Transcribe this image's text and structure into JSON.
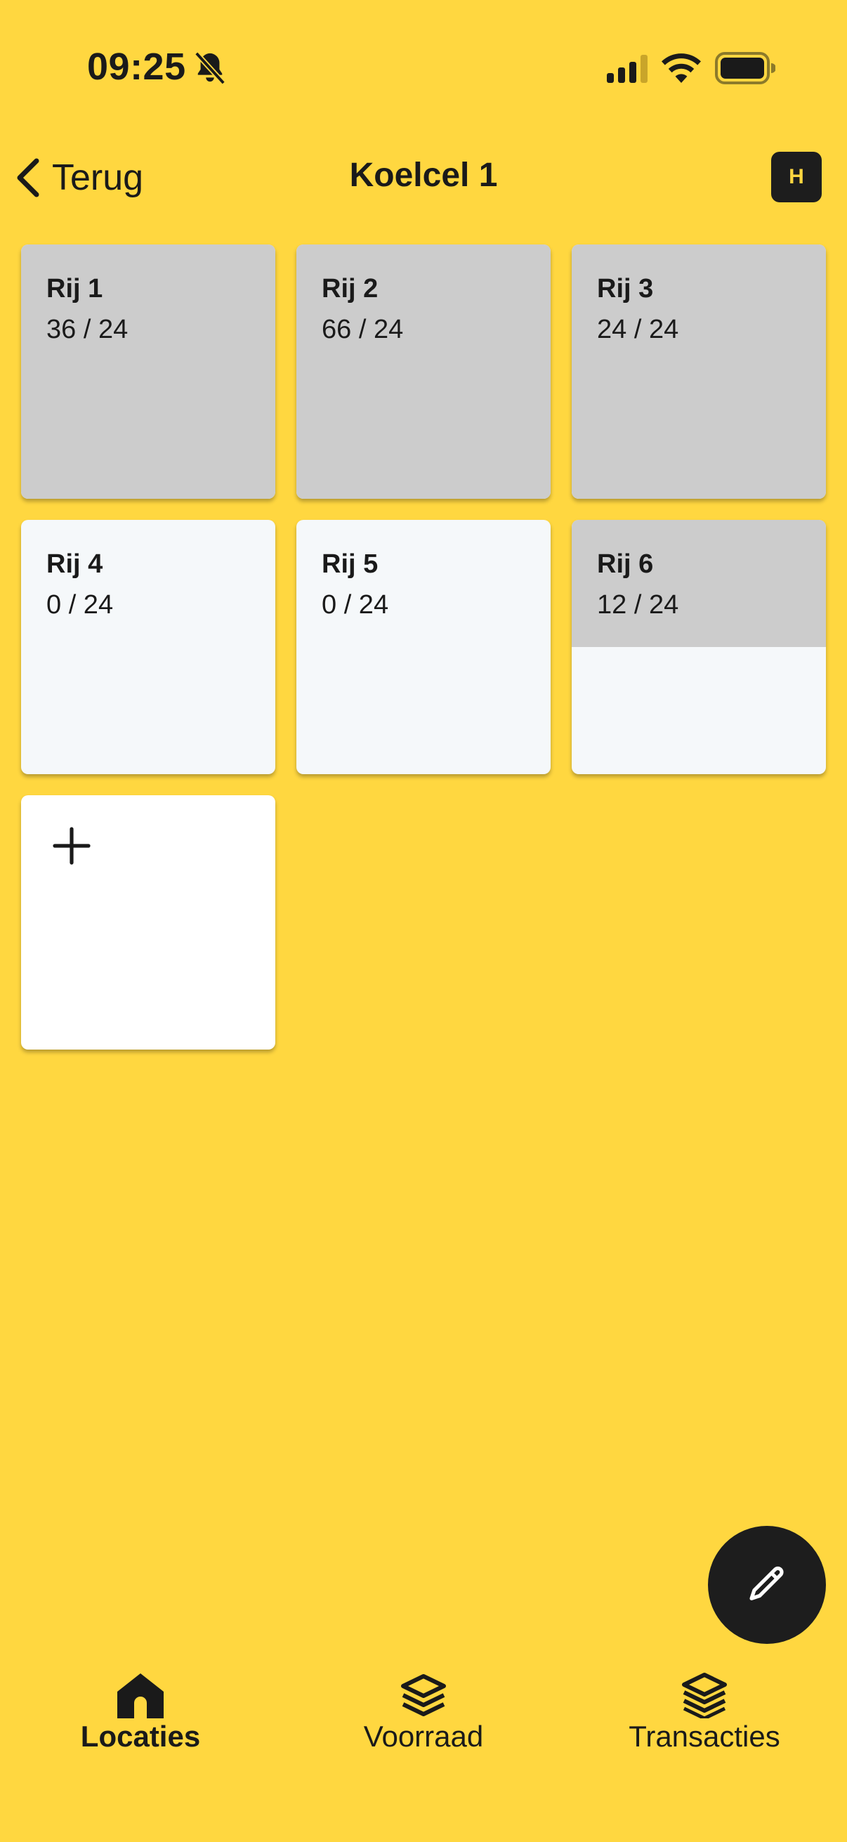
{
  "status_bar": {
    "time": "09:25"
  },
  "header": {
    "back_label": "Terug",
    "title": "Koelcel 1",
    "avatar_initial": "H"
  },
  "rows": [
    {
      "name": "Rij 1",
      "count": "36 / 24",
      "fill": 1.0
    },
    {
      "name": "Rij 2",
      "count": "66 / 24",
      "fill": 1.0
    },
    {
      "name": "Rij 3",
      "count": "24 / 24",
      "fill": 1.0
    },
    {
      "name": "Rij 4",
      "count": "0 / 24",
      "fill": 0.0
    },
    {
      "name": "Rij 5",
      "count": "0 / 24",
      "fill": 0.0
    },
    {
      "name": "Rij 6",
      "count": "12 / 24",
      "fill": 0.5
    }
  ],
  "nav": {
    "items": [
      {
        "label": "Locaties",
        "icon": "home-icon",
        "active": true
      },
      {
        "label": "Voorraad",
        "icon": "layers-icon",
        "active": false
      },
      {
        "label": "Transacties",
        "icon": "layers-stack-icon",
        "active": false
      }
    ]
  },
  "colors": {
    "background": "#FFD740",
    "filled": "#CCCCCC",
    "empty": "#F5F8FA",
    "dark": "#1D1D1D"
  }
}
